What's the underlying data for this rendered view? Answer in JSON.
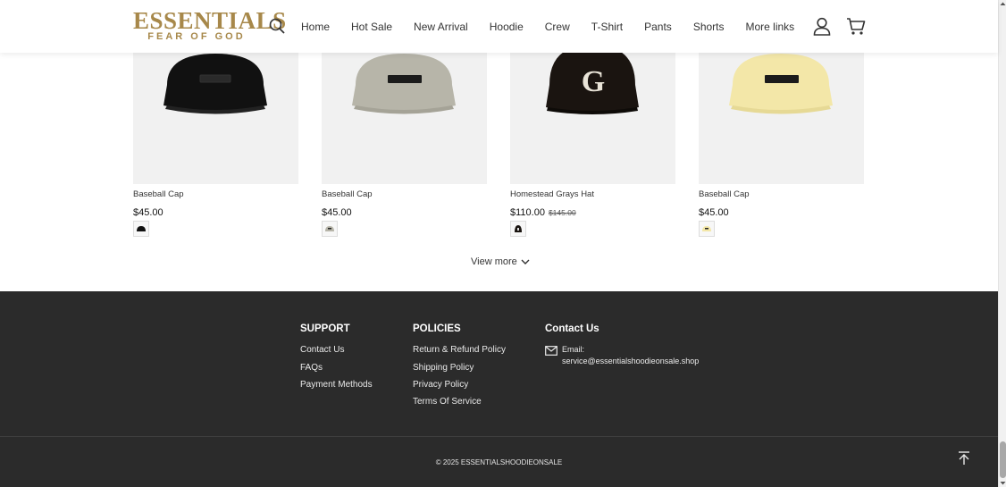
{
  "header": {
    "logo_main": "ESSENTIALS",
    "logo_sub": "FEAR OF GOD",
    "nav": [
      "Home",
      "Hot Sale",
      "New Arrival",
      "Hoodie",
      "Crew",
      "T-Shirt",
      "Pants",
      "Shorts",
      "More links"
    ],
    "icons": [
      "search-icon",
      "user-icon",
      "cart-icon"
    ],
    "brand_color": "#a7884a"
  },
  "products": [
    {
      "title": "Baseball Cap",
      "price": "$45.00",
      "color": "#111111",
      "swatch": "#111111"
    },
    {
      "title": "Baseball Cap",
      "price": "$45.00",
      "color": "#b7b5a9",
      "swatch": "#b7b5a9"
    },
    {
      "title": "Homestead Grays Hat",
      "price": "$110.00",
      "old_price": "$145.00",
      "color": "#1a1410",
      "swatch": "#1a1410"
    },
    {
      "title": "Baseball Cap",
      "price": "$45.00",
      "color": "#f3e7a8",
      "swatch": "#f3e7a8"
    }
  ],
  "view_more": "View more",
  "footer": {
    "support": {
      "heading": "SUPPORT",
      "links": [
        "Contact Us",
        "FAQs",
        "Payment Methods"
      ]
    },
    "policies": {
      "heading": "POLICIES",
      "links": [
        "Return & Refund Policy",
        "Shipping Policy",
        "Privacy Policy",
        "Terms Of Service"
      ]
    },
    "contact": {
      "heading": "Contact Us",
      "email_label": "Email:",
      "email": "service@essentialshoodieonsale.shop"
    },
    "copyright": "© 2025 ESSENTIALSHOODIEONSALE",
    "background": "#2b2b2b"
  }
}
